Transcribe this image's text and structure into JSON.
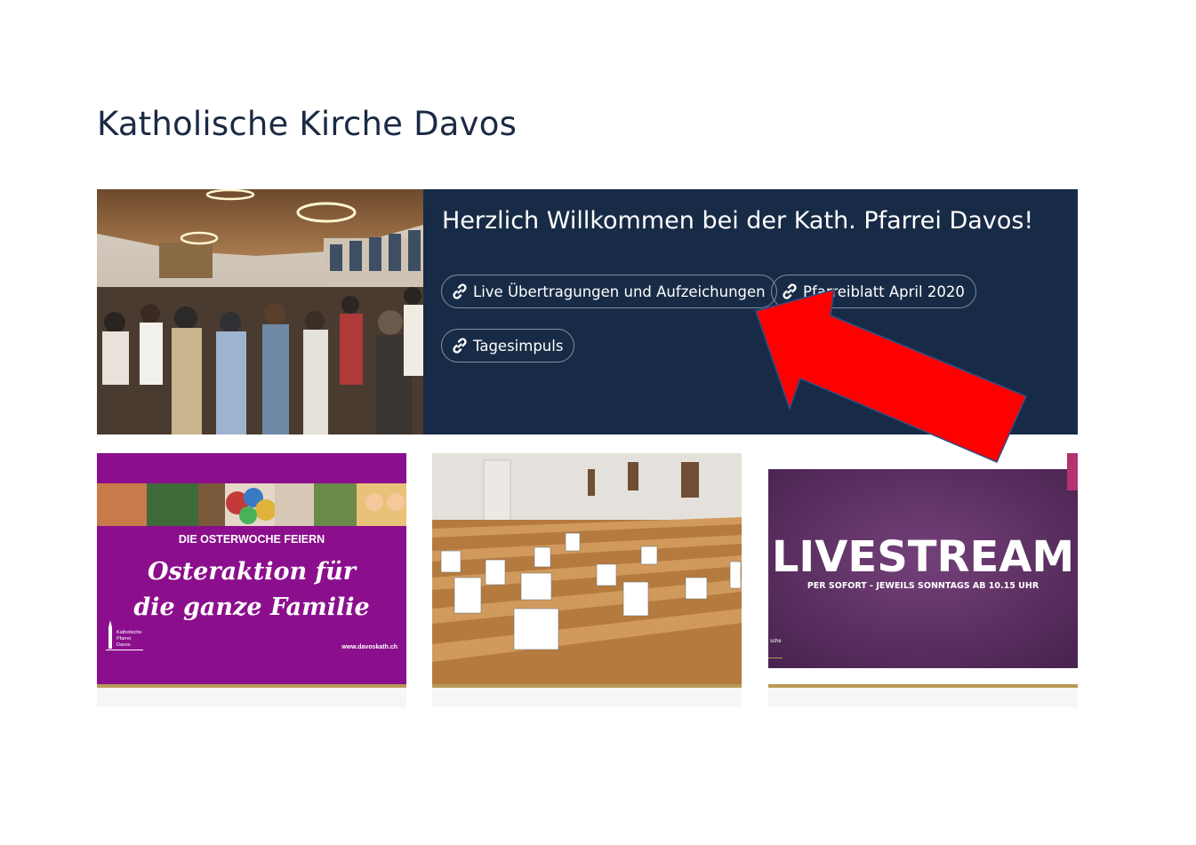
{
  "page": {
    "title": "Katholische Kirche Davos"
  },
  "hero": {
    "heading": "Herzlich Willkommen bei der Kath. Pfarrei Davos!",
    "links": [
      {
        "label": "Live Übertragungen und Aufzeichungen",
        "icon": "link-icon"
      },
      {
        "label": "Pfarreiblatt April 2020",
        "icon": "link-icon"
      },
      {
        "label": "Tagesimpuls",
        "icon": "link-icon"
      }
    ]
  },
  "cards": [
    {
      "banner": "DIE OSTERWOCHE FEIERN",
      "title_line1": "Osteraktion für",
      "title_line2": "die ganze Familie",
      "logo_line1": "Katholische",
      "logo_line2": "Pfarrei",
      "logo_line3": "Davos",
      "url": "www.davoskath.ch"
    },
    {
      "image": "church-pews-with-photos"
    },
    {
      "headline": "LIVESTREAM",
      "subline": "PER SOFORT - JEWEILS SONNTAGS AB 10.15 UHR",
      "corner_text": "sche"
    }
  ],
  "colors": {
    "navy": "#182b46",
    "purple_card": "#8b0f8c",
    "livestream_bg": "#5b2e62",
    "gold_rule": "#b89a54",
    "annotation_arrow": "#ff0000"
  }
}
